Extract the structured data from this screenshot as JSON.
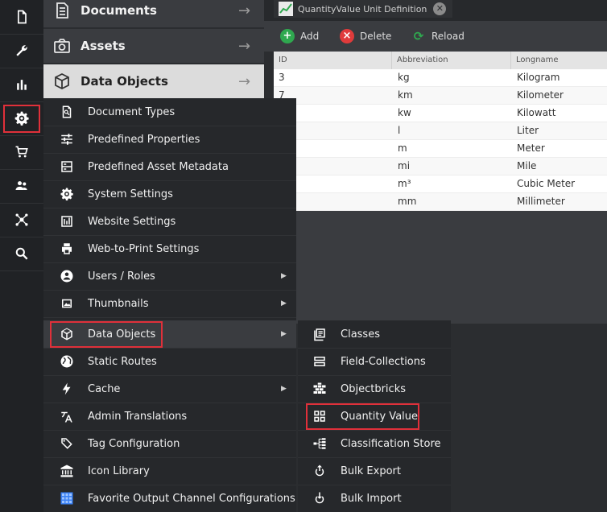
{
  "nav": {
    "documents": "Documents",
    "assets": "Assets",
    "data_objects": "Data Objects"
  },
  "rail": [
    "document-icon",
    "wrench-icon",
    "chart-icon",
    "gear-icon",
    "cart-icon",
    "users-icon",
    "network-icon",
    "search-icon"
  ],
  "tab": {
    "title": "QuantityValue Unit Definition",
    "close": "✕"
  },
  "toolbar": {
    "add": "Add",
    "delete": "Delete",
    "reload": "Reload"
  },
  "grid": {
    "columns": [
      "ID",
      "Abbreviation",
      "Longname"
    ],
    "rows": [
      {
        "id": "3",
        "abbr": "kg",
        "long": "Kilogram"
      },
      {
        "id": "7",
        "abbr": "km",
        "long": "Kilometer"
      },
      {
        "id": "",
        "abbr": "kw",
        "long": "Kilowatt"
      },
      {
        "id": "",
        "abbr": "l",
        "long": "Liter"
      },
      {
        "id": "",
        "abbr": "m",
        "long": "Meter"
      },
      {
        "id": "",
        "abbr": "mi",
        "long": "Mile"
      },
      {
        "id": "",
        "abbr": "m³",
        "long": "Cubic Meter"
      },
      {
        "id": "",
        "abbr": "mm",
        "long": "Millimeter"
      }
    ]
  },
  "menu": {
    "document_types": "Document Types",
    "predefined_properties": "Predefined Properties",
    "predefined_asset_metadata": "Predefined Asset Metadata",
    "system_settings": "System Settings",
    "website_settings": "Website Settings",
    "web_to_print": "Web-to-Print Settings",
    "users_roles": "Users / Roles",
    "thumbnails": "Thumbnails",
    "data_objects": "Data Objects",
    "static_routes": "Static Routes",
    "cache": "Cache",
    "admin_translations": "Admin Translations",
    "tag_configuration": "Tag Configuration",
    "icon_library": "Icon Library",
    "favorite_output": "Favorite Output Channel Configurations"
  },
  "submenu": {
    "classes": "Classes",
    "field_collections": "Field-Collections",
    "objectbricks": "Objectbricks",
    "quantity_value": "Quantity Value",
    "classification_store": "Classification Store",
    "bulk_export": "Bulk Export",
    "bulk_import": "Bulk Import"
  },
  "colors": {
    "highlight": "#e0303a",
    "add": "#2fa84f",
    "delete": "#e03b3b",
    "reload": "#2fa84f"
  }
}
